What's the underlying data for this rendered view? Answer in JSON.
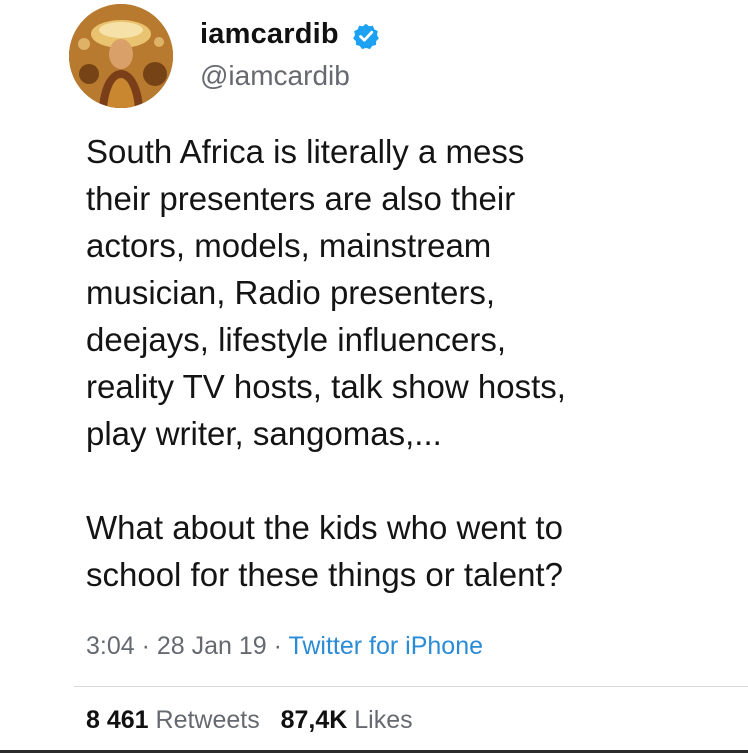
{
  "user": {
    "display_name": "iamcardib",
    "handle": "@iamcardib",
    "verified_icon": "verified-badge-icon",
    "avatar": "profile-avatar"
  },
  "tweet": {
    "lines": [
      "South Africa is literally a mess",
      "their presenters are also their",
      "actors, models, mainstream",
      "musician, Radio presenters,",
      "deejays, lifestyle influencers,",
      "reality TV hosts, talk show hosts,",
      "play writer, sangomas,..."
    ],
    "lines2": [
      "What about the kids who went to",
      "school for these things or talent?"
    ]
  },
  "meta": {
    "time": "3:04",
    "sep1": " · ",
    "date": "28 Jan 19",
    "sep2": " · ",
    "source": "Twitter for iPhone"
  },
  "stats": {
    "retweets_count": "8 461",
    "retweets_label": "Retweets",
    "likes_count": "87,4K",
    "likes_label": "Likes"
  },
  "colors": {
    "verified": "#1da1f2",
    "link": "#2a8bd6",
    "secondary_text": "#666a70"
  }
}
